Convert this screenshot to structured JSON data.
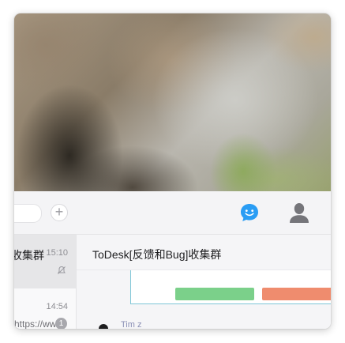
{
  "toolbar": {
    "add_label": "+",
    "chat_tab_icon": "chat-bubble-smile-icon",
    "contacts_tab_icon": "person-icon",
    "accent_color": "#2a9df4"
  },
  "conversations": [
    {
      "name": "ToDesk[反馈和Bug]收集群",
      "time": "15:10",
      "muted": true,
      "selected": true
    },
    {
      "name": "",
      "time": "14:54",
      "preview": "https://ww...",
      "unread": "1",
      "selected": false
    }
  ],
  "chat": {
    "title": "ToDesk[反馈和Bug]收集群",
    "sender_name": "Tim z"
  }
}
